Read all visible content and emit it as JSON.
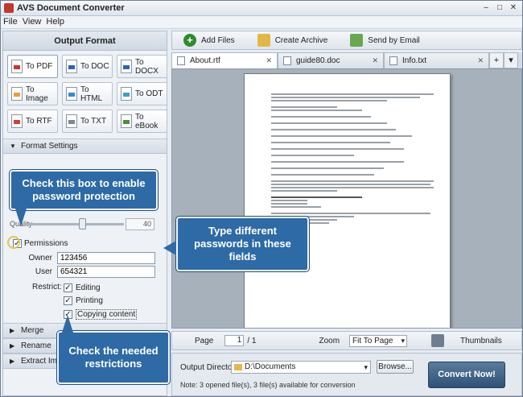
{
  "window": {
    "title": "AVS Document Converter",
    "controls": [
      "–",
      "□",
      "✕"
    ]
  },
  "menu": [
    "File",
    "View",
    "Help"
  ],
  "left": {
    "header": "Output Format",
    "formats": [
      "To PDF",
      "To DOC",
      "To DOCX",
      "To Image",
      "To HTML",
      "To ODT",
      "To RTF",
      "To TXT",
      "To eBook"
    ],
    "format_settings": "Format Settings",
    "quality_label": "Quality",
    "quality_value": "40",
    "permissions_label": "Permissions",
    "owner_label": "Owner",
    "owner_value": "123456",
    "user_label": "User",
    "user_value": "654321",
    "restrict_label": "Restrict:",
    "restrictions": [
      "Editing",
      "Printing",
      "Copying content"
    ],
    "sections": [
      "Merge",
      "Rename",
      "Extract Images"
    ]
  },
  "toolbar": {
    "add": "Add Files",
    "archive": "Create Archive",
    "mail": "Send by Email"
  },
  "tabs": [
    "About.rtf",
    "guide80.doc",
    "Info.txt"
  ],
  "pager": {
    "page_label": "Page",
    "page": "1",
    "total": "/ 1",
    "zoom_label": "Zoom",
    "zoom": "Fit To Page",
    "thumbnails": "Thumbnails"
  },
  "bottom": {
    "outdir_label": "Output Directory:",
    "outdir": "D:\\Documents",
    "browse": "Browse...",
    "note": "Note: 3 opened file(s), 3 file(s) available for conversion",
    "convert": "Convert Now!"
  },
  "callouts": {
    "c1": "Check this box to enable password protection",
    "c2": "Type different passwords in these fields",
    "c3": "Check the needed restrictions"
  },
  "colors": {
    "callout": "#2d6aa6",
    "convert": "#2f5276"
  }
}
